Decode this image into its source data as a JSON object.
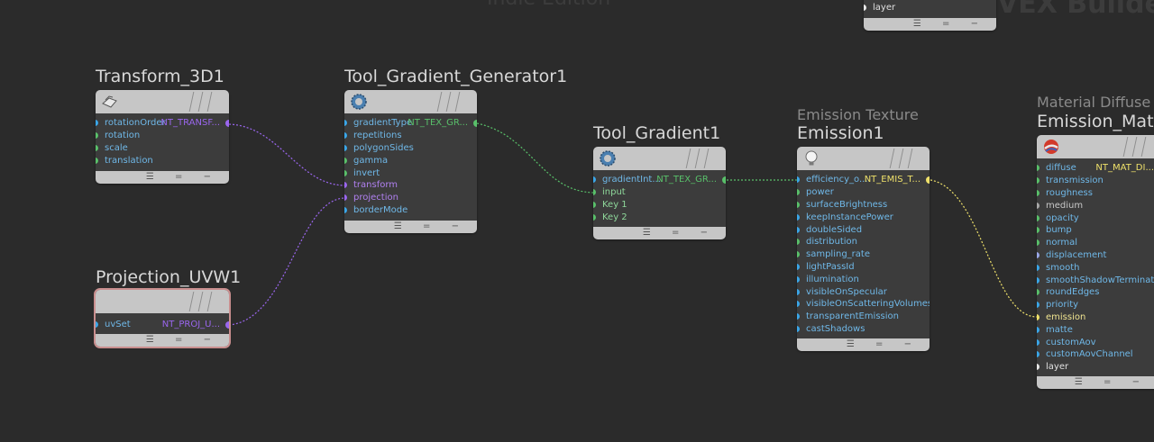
{
  "watermarks": {
    "edition": "Indie Edition",
    "context": "VEX Builder"
  },
  "colors": {
    "background": "#2b2b2b",
    "blue": "#3aa6e8",
    "green": "#59c06a",
    "purple": "#9a66ee",
    "yellow": "#eee06a",
    "gray": "#a8a8a8",
    "white": "#e8e8e8",
    "periwinkle": "#9aa8e8"
  },
  "nodes": {
    "transform": {
      "title": "Transform_3D1",
      "icon": "transform-icon",
      "inputs": [
        "rotationOrder",
        "rotation",
        "scale",
        "translation"
      ],
      "output": "NT_TRANSF..."
    },
    "gradient_generator": {
      "title": "Tool_Gradient_Generator1",
      "icon": "gear-icon",
      "inputs": [
        "gradientType",
        "repetitions",
        "polygonSides",
        "gamma",
        "invert",
        "transform",
        "projection",
        "borderMode"
      ],
      "output": "NT_TEX_GR..."
    },
    "projection": {
      "title": "Projection_UVW1",
      "inputs": [
        "uvSet"
      ],
      "output": "NT_PROJ_U..."
    },
    "gradient": {
      "title": "Tool_Gradient1",
      "icon": "gear-icon",
      "inputs": [
        "gradientInt...",
        "input",
        "Key 1",
        "Key 2"
      ],
      "output": "NT_TEX_GR..."
    },
    "emission": {
      "subtitle": "Emission Texture",
      "title": "Emission1",
      "icon": "lightbulb-icon",
      "inputs": [
        "efficiency_o...",
        "power",
        "surfaceBrightness",
        "keepInstancePower",
        "doubleSided",
        "distribution",
        "sampling_rate",
        "lightPassId",
        "illumination",
        "visibleOnSpecular",
        "visibleOnScatteringVolumes",
        "transparentEmission",
        "castShadows"
      ],
      "output": "NT_EMIS_T..."
    },
    "material": {
      "subtitle": "Material Diffuse",
      "title": "Emission_Mate",
      "icon": "sphere-icon",
      "inputs": [
        "diffuse",
        "transmission",
        "roughness",
        "medium",
        "opacity",
        "bump",
        "normal",
        "displacement",
        "smooth",
        "smoothShadowTerminator",
        "roundEdges",
        "priority",
        "emission",
        "matte",
        "customAov",
        "customAovChannel",
        "layer"
      ],
      "output": "NT_MAT_DI..."
    },
    "top": {
      "inputs": [
        "layer"
      ]
    }
  },
  "footer_controls": "☰ = −"
}
